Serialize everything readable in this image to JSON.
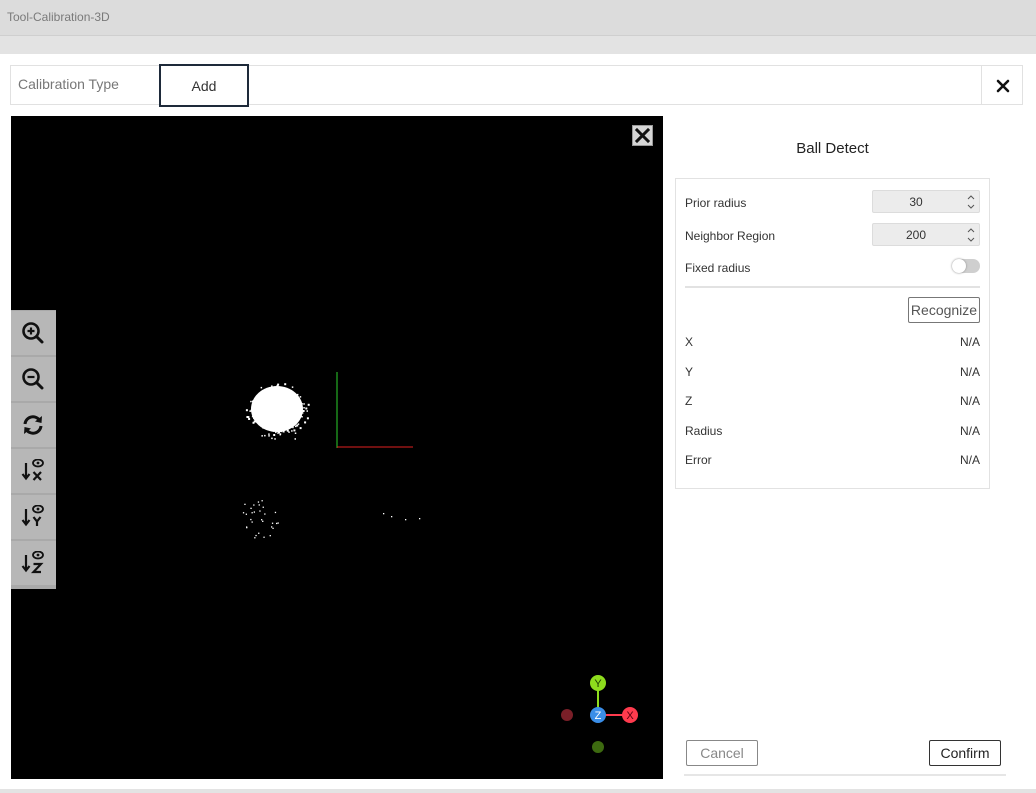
{
  "app": {
    "title": "Tool-Calibration-3D"
  },
  "calibration": {
    "type_label": "Calibration Type",
    "add_tab": "Add"
  },
  "panel": {
    "title": "Ball Detect",
    "params": [
      {
        "label": "Prior radius",
        "value": "30"
      },
      {
        "label": "Neighbor Region",
        "value": "200"
      }
    ],
    "fixed_radius": {
      "label": "Fixed radius",
      "enabled": false
    },
    "recognize_label": "Recognize",
    "results": [
      {
        "label": "X",
        "value": "N/A"
      },
      {
        "label": "Y",
        "value": "N/A"
      },
      {
        "label": "Z",
        "value": "N/A"
      },
      {
        "label": "Radius",
        "value": "N/A"
      },
      {
        "label": "Error",
        "value": "N/A"
      }
    ]
  },
  "actions": {
    "cancel_label": "Cancel",
    "confirm_label": "Confirm"
  },
  "viewer": {
    "toolbar": [
      "zoom-in-icon",
      "zoom-out-icon",
      "reset-view-icon",
      "view-x-axis-icon",
      "view-y-axis-icon",
      "view-z-axis-icon"
    ],
    "gizmo": {
      "y_label": "Y",
      "z_label": "Z",
      "x_label": "X"
    }
  },
  "colors": {
    "axis_x": "#ff3b4e",
    "axis_y": "#8edc1d",
    "axis_z": "#3a8ee8",
    "axis_neg_x": "#7a1f28",
    "axis_neg_y": "#3d6a10",
    "point_cloud": "#ffffff",
    "button_border_dark": "#1e2a3a"
  }
}
